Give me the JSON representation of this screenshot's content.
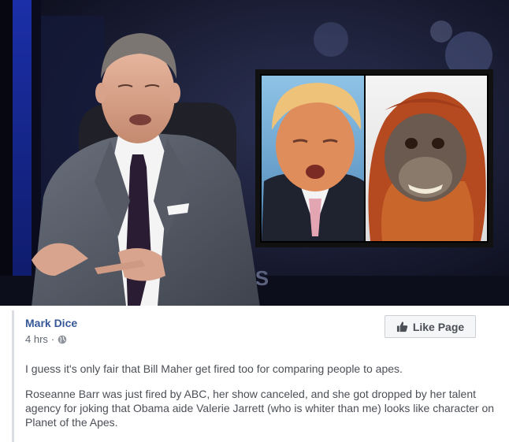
{
  "post": {
    "author": "Mark Dice",
    "time": "4 hrs",
    "separator": "·",
    "like_button_label": "Like Page",
    "paragraphs": [
      "I guess it's only fair that Bill Maher get fired too for comparing people to apes.",
      "Roseanne Barr was just fired by ABC, her show canceled, and she got dropped by her talent agency for joking that Obama aide Valerie Jarrett (who is whiter than me) looks like character on Planet of the Apes."
    ]
  },
  "image": {
    "background_text": "RS"
  },
  "colors": {
    "link": "#365899",
    "body_text": "#4b4f56",
    "meta_text": "#606770"
  },
  "icons": {
    "privacy": "globe-icon",
    "like": "thumbs-up-icon"
  }
}
